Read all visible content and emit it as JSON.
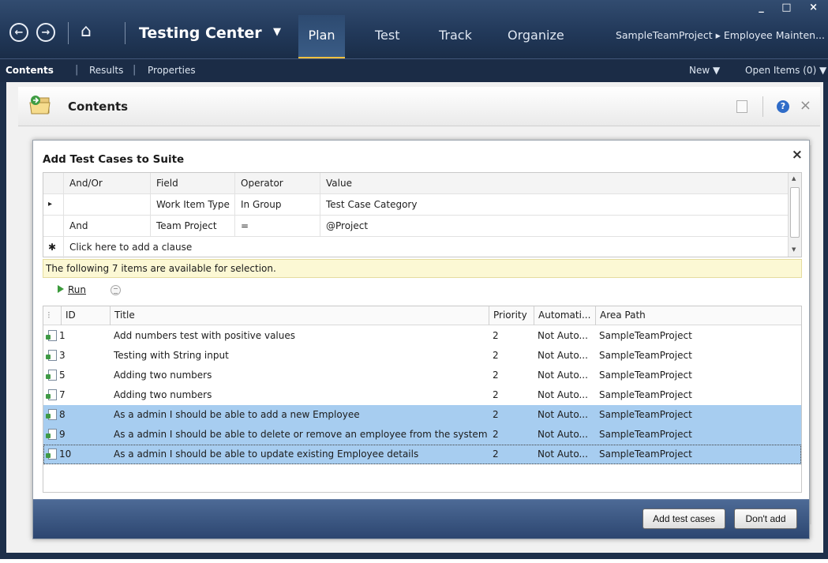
{
  "titlebar": {
    "window_controls": "_ □ ×",
    "back_glyph": "←",
    "forward_glyph": "→",
    "home_glyph": "⌂",
    "center_title": "Testing Center",
    "center_caret": "▼",
    "activities": [
      "Plan",
      "Test",
      "Track",
      "Organize"
    ],
    "breadcrumb": "SampleTeamProject ▸ Employee Mainten..."
  },
  "ribbon": {
    "items": [
      "Contents",
      "Results",
      "Properties"
    ],
    "new_label": "New ▼",
    "open_items": "Open Items (0) ▼"
  },
  "contents_header": {
    "title": "Contents",
    "help_glyph": "?",
    "close_glyph": "×"
  },
  "dialog": {
    "title": "Add Test Cases to Suite",
    "close_glyph": "×",
    "query": {
      "columns": [
        "And/Or",
        "Field",
        "Operator",
        "Value"
      ],
      "rows": [
        {
          "marker": "▸",
          "and_or": "",
          "field": "Work Item Type",
          "operator": "In Group",
          "value": "Test Case Category"
        },
        {
          "marker": "",
          "and_or": "And",
          "field": "Team Project",
          "operator": "=",
          "value": "@Project"
        }
      ],
      "new_row_marker": "✱",
      "add_clause": "Click here to add a clause"
    },
    "info_text": "The following 7 items are available for selection.",
    "run_label": "Run",
    "results": {
      "columns": [
        "ID",
        "Title",
        "Priority",
        "Automati...",
        "Area Path"
      ],
      "rows": [
        {
          "id": "1",
          "title": "Add numbers test with positive values",
          "priority": "2",
          "automation": "Not Auto...",
          "area": "SampleTeamProject",
          "selected": false
        },
        {
          "id": "3",
          "title": "Testing with String input",
          "priority": "2",
          "automation": "Not Auto...",
          "area": "SampleTeamProject",
          "selected": false
        },
        {
          "id": "5",
          "title": "Adding two numbers",
          "priority": "2",
          "automation": "Not Auto...",
          "area": "SampleTeamProject",
          "selected": false
        },
        {
          "id": "7",
          "title": "Adding two numbers",
          "priority": "2",
          "automation": "Not Auto...",
          "area": "SampleTeamProject",
          "selected": false
        },
        {
          "id": "8",
          "title": "As a admin I should be able to add a new Employee",
          "priority": "2",
          "automation": "Not Auto...",
          "area": "SampleTeamProject",
          "selected": true
        },
        {
          "id": "9",
          "title": "As a admin I should be able to delete or remove an employee from the system",
          "priority": "2",
          "automation": "Not Auto...",
          "area": "SampleTeamProject",
          "selected": true
        },
        {
          "id": "10",
          "title": "As a admin I should be able to update existing Employee details",
          "priority": "2",
          "automation": "Not Auto...",
          "area": "SampleTeamProject",
          "selected": true
        }
      ]
    },
    "buttons": {
      "add": "Add test cases",
      "dont_add": "Don't add"
    }
  },
  "colors": {
    "titlebar": "#22395a",
    "selection": "#a7cdf0",
    "info_bar": "#fcf8d4",
    "footer": "#3a5783"
  }
}
